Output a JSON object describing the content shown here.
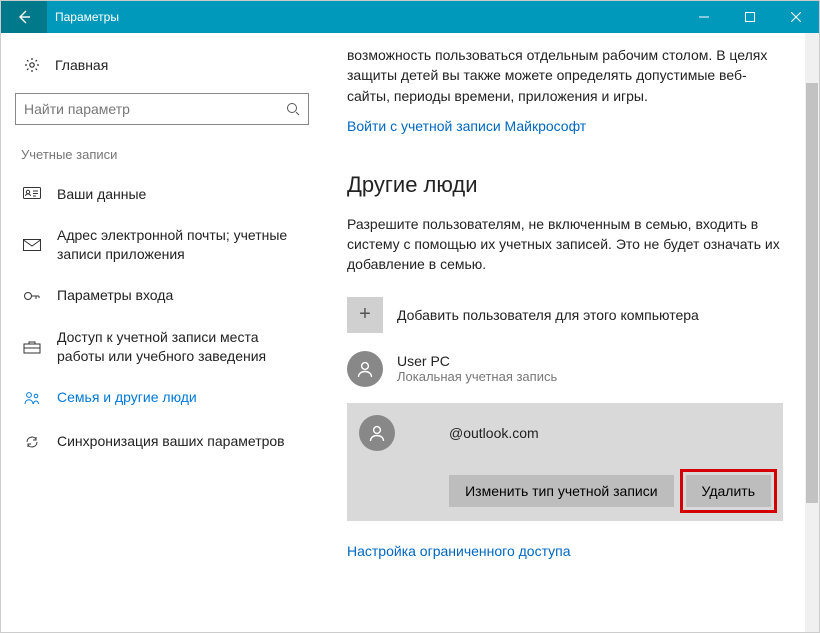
{
  "window": {
    "title": "Параметры"
  },
  "sidebar": {
    "home_label": "Главная",
    "search_placeholder": "Найти параметр",
    "section_label": "Учетные записи",
    "items": [
      {
        "label": "Ваши данные"
      },
      {
        "label": "Адрес электронной почты; учетные записи приложения"
      },
      {
        "label": "Параметры входа"
      },
      {
        "label": "Доступ к учетной записи места работы или учебного заведения"
      },
      {
        "label": "Семья и другие люди"
      },
      {
        "label": "Синхронизация ваших параметров"
      }
    ]
  },
  "content": {
    "intro_text": "возможность пользоваться отдельным рабочим столом. В целях защиты детей вы также можете определять допустимые веб-сайты, периоды времени, приложения и игры.",
    "signin_link": "Войти с учетной записи Майкрософт",
    "section_title": "Другие люди",
    "section_desc": "Разрешите пользователям, не включенным в семью, входить в систему с помощью их учетных записей. Это не будет означать их добавление в семью.",
    "add_user_label": "Добавить пользователя для этого компьютера",
    "user1": {
      "name": "User PC",
      "desc": "Локальная учетная запись"
    },
    "user2": {
      "name": "@outlook.com"
    },
    "btn_change_type": "Изменить тип учетной записи",
    "btn_delete": "Удалить",
    "restricted_link": "Настройка ограниченного доступа"
  }
}
